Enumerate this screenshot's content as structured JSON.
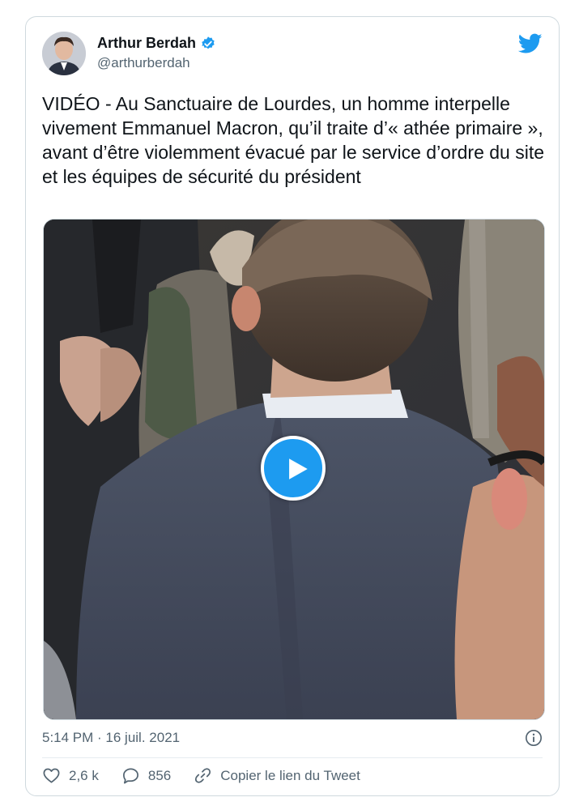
{
  "author": {
    "display_name": "Arthur Berdah",
    "handle": "@arthurberdah",
    "verified": true
  },
  "tweet": {
    "text": "VIDÉO - Au Sanctuaire de Lourdes, un homme interpelle vivement Emmanuel Macron, qu’il traite d’« athée primaire », avant d’être violemment évacué par le service d’ordre du site et les équipes de sécurité du président",
    "timestamp": "5:14 PM · 16 juil. 2021",
    "media_type": "video"
  },
  "actions": {
    "likes": "2,6 k",
    "replies": "856",
    "copy_link_label": "Copier le lien du Tweet"
  },
  "icons": {
    "brand": "twitter-bird-icon",
    "verified": "verified-badge-icon",
    "play": "play-icon",
    "info": "info-icon",
    "like": "heart-icon",
    "reply": "reply-bubble-icon",
    "link": "link-icon"
  },
  "colors": {
    "accent": "#1d9bf0",
    "secondary_text": "#536471",
    "border": "#cfd9de"
  }
}
